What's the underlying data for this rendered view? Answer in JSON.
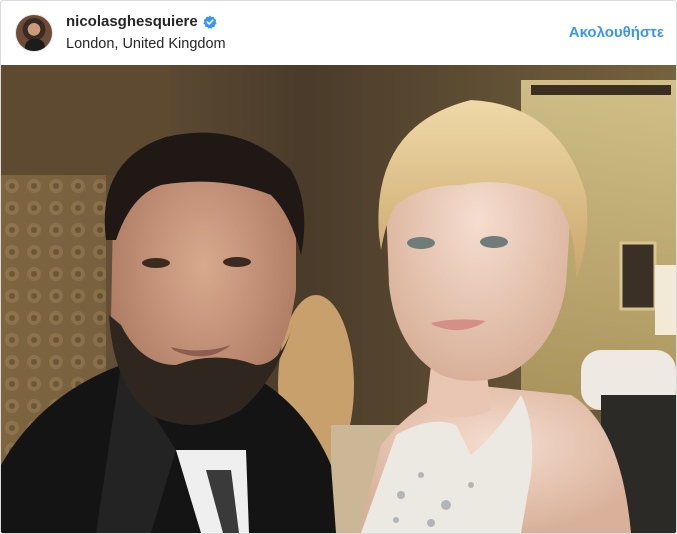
{
  "post": {
    "username": "nicolasghesquiere",
    "location": "London, United Kingdom",
    "follow_label": "Ακολουθήστε"
  },
  "icons": {
    "verified": "verified-badge-icon"
  },
  "colors": {
    "accent": "#3897f0",
    "text": "#262626",
    "border": "#dbdbdb"
  }
}
